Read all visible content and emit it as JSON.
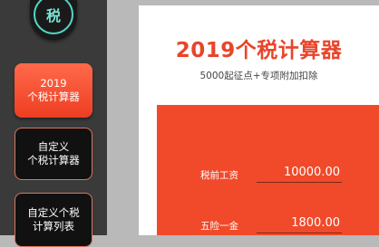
{
  "logo": {
    "glyph": "税"
  },
  "sidebar": {
    "items": [
      {
        "label": "2019\n个税计算器",
        "active": true
      },
      {
        "label": "自定义\n个税计算器",
        "active": false
      },
      {
        "label": "自定义个税\n计算列表",
        "active": false
      }
    ]
  },
  "main": {
    "title": "2019个税计算器",
    "subtitle": "5000起征点+专项附加扣除",
    "fields": [
      {
        "label": "税前工资",
        "value": "10000.00"
      },
      {
        "label": "五险一金",
        "value": "1800.00"
      }
    ]
  },
  "colors": {
    "accent": "#f04a2a",
    "title": "#e8452b",
    "sidebar_bg": "#3a3a3a",
    "logo_ring": "#55d7c6"
  }
}
